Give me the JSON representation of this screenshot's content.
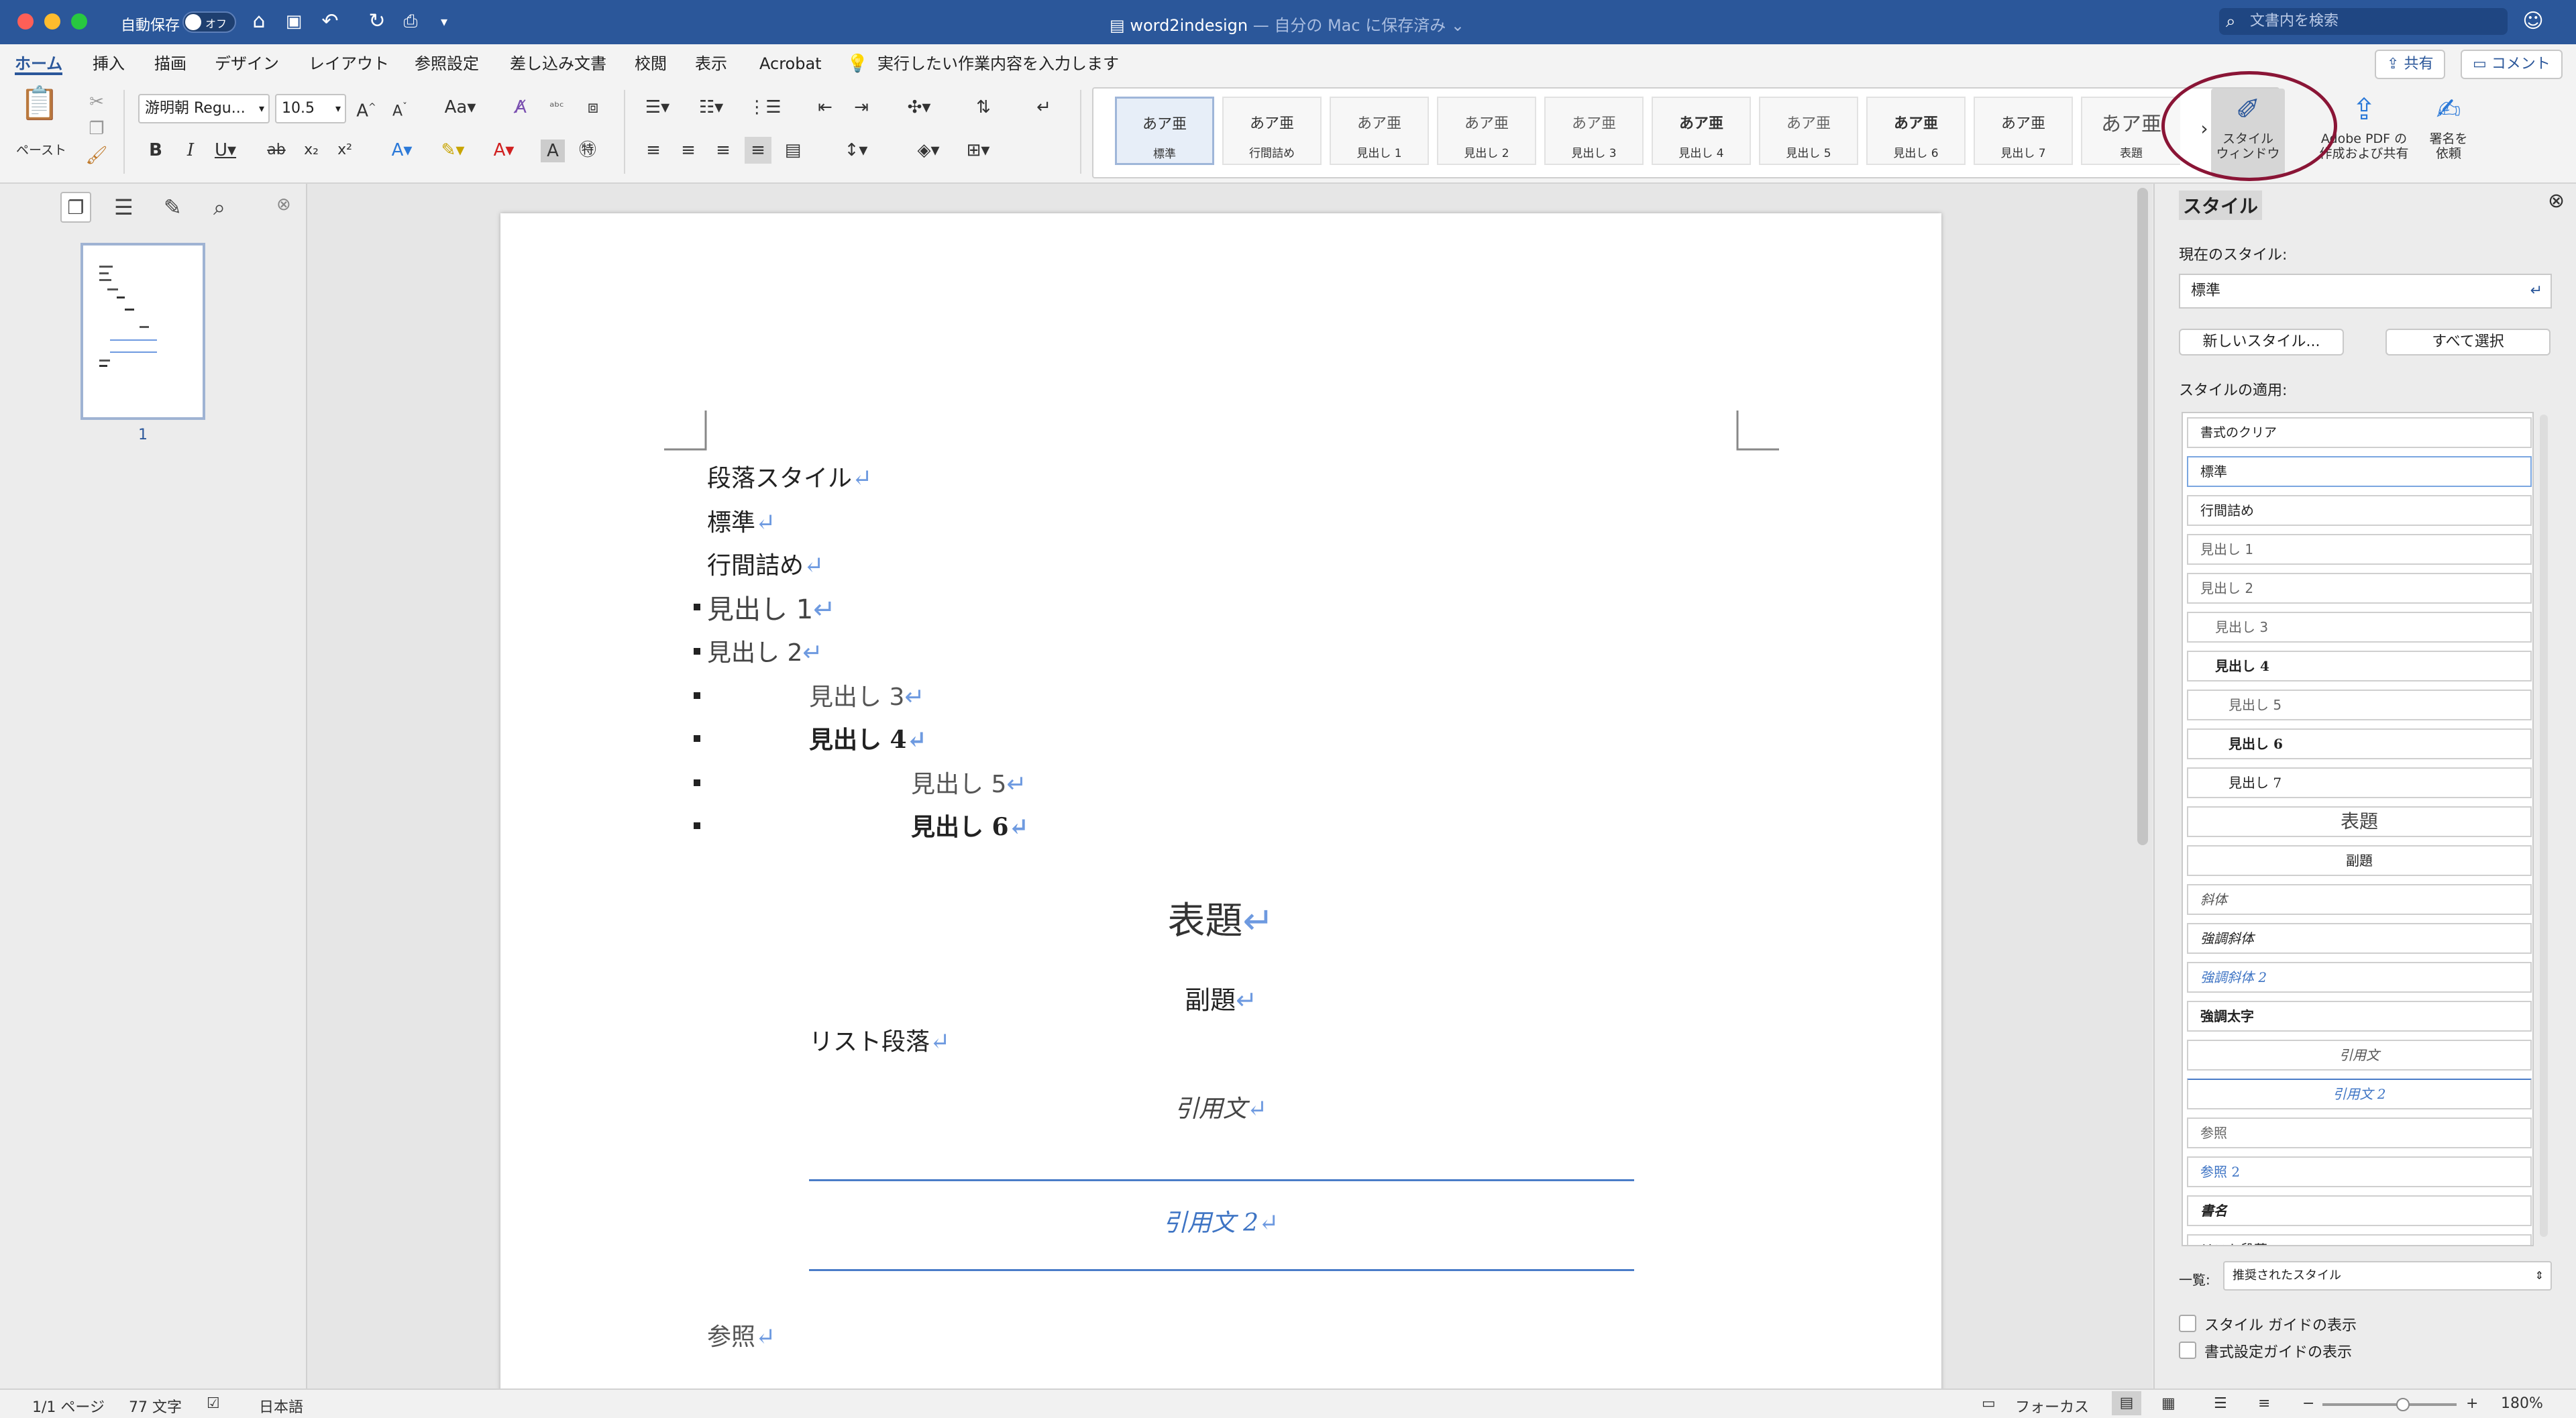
{
  "titlebar": {
    "autosave_label": "自動保存",
    "autosave_toggle": "オフ",
    "doc_title": "word2indesign",
    "save_state": "— 自分の Mac に保存済み ⌄",
    "search_placeholder": "文書内を検索"
  },
  "ribbon_tabs": [
    "ホーム",
    "挿入",
    "描画",
    "デザイン",
    "レイアウト",
    "参照設定",
    "差し込み文書",
    "校閲",
    "表示",
    "Acrobat"
  ],
  "tell_me": "実行したい作業内容を入力します",
  "share_label": "共有",
  "comment_label": "コメント",
  "ribbon": {
    "paste_label": "ペースト",
    "font_name": "游明朝 Regu...",
    "font_size": "10.5",
    "gallery_more": "›",
    "style_window_label_1": "スタイル",
    "style_window_label_2": "ウィンドウ",
    "adobe_label_1": "Adobe PDF の",
    "adobe_label_2": "作成および共有",
    "sign_label_1": "署名を",
    "sign_label_2": "依頼"
  },
  "style_gallery": [
    {
      "sample": "あア亜",
      "name": "標準"
    },
    {
      "sample": "あア亜",
      "name": "行間詰め"
    },
    {
      "sample": "あア亜",
      "name": "見出し 1"
    },
    {
      "sample": "あア亜",
      "name": "見出し 2"
    },
    {
      "sample": "あア亜",
      "name": "見出し 3"
    },
    {
      "sample": "あア亜",
      "name": "見出し 4"
    },
    {
      "sample": "あア亜",
      "name": "見出し 5"
    },
    {
      "sample": "あア亜",
      "name": "見出し 6"
    },
    {
      "sample": "あア亜",
      "name": "見出し 7"
    },
    {
      "sample": "あア亜",
      "name": "表題"
    }
  ],
  "nav": {
    "page_number": "1"
  },
  "document": {
    "lines": [
      "段落スタイル",
      "標準",
      "行間詰め",
      "見出し 1",
      "見出し 2",
      "見出し 3",
      "見出し 4",
      "見出し 5",
      "見出し 6",
      "表題",
      "副題",
      "リスト段落",
      "引用文",
      "引用文 2",
      "参照"
    ],
    "pilcrow": "↵"
  },
  "styles_pane": {
    "title": "スタイル",
    "current_label": "現在のスタイル:",
    "current_value": "標準",
    "new_style": "新しいスタイル...",
    "select_all": "すべて選択",
    "apply_label": "スタイルの適用:",
    "items": [
      "書式のクリア",
      "標準",
      "行間詰め",
      "見出し 1",
      "見出し 2",
      "見出し 3",
      "見出し 4",
      "見出し 5",
      "見出し 6",
      "見出し 7",
      "表題",
      "副題",
      "斜体",
      "強調斜体",
      "強調斜体 2",
      "強調太字",
      "引用文",
      "引用文 2",
      "参照",
      "参照 2",
      "書名",
      "リスト段落"
    ],
    "list_label": "一覧:",
    "list_value": "推奨されたスタイル",
    "show_guide": "スタイル ガイドの表示",
    "show_format_guide": "書式設定ガイドの表示"
  },
  "status": {
    "page": "1/1 ページ",
    "words": "77 文字",
    "language": "日本語",
    "focus": "フォーカス",
    "zoom": "180%"
  }
}
